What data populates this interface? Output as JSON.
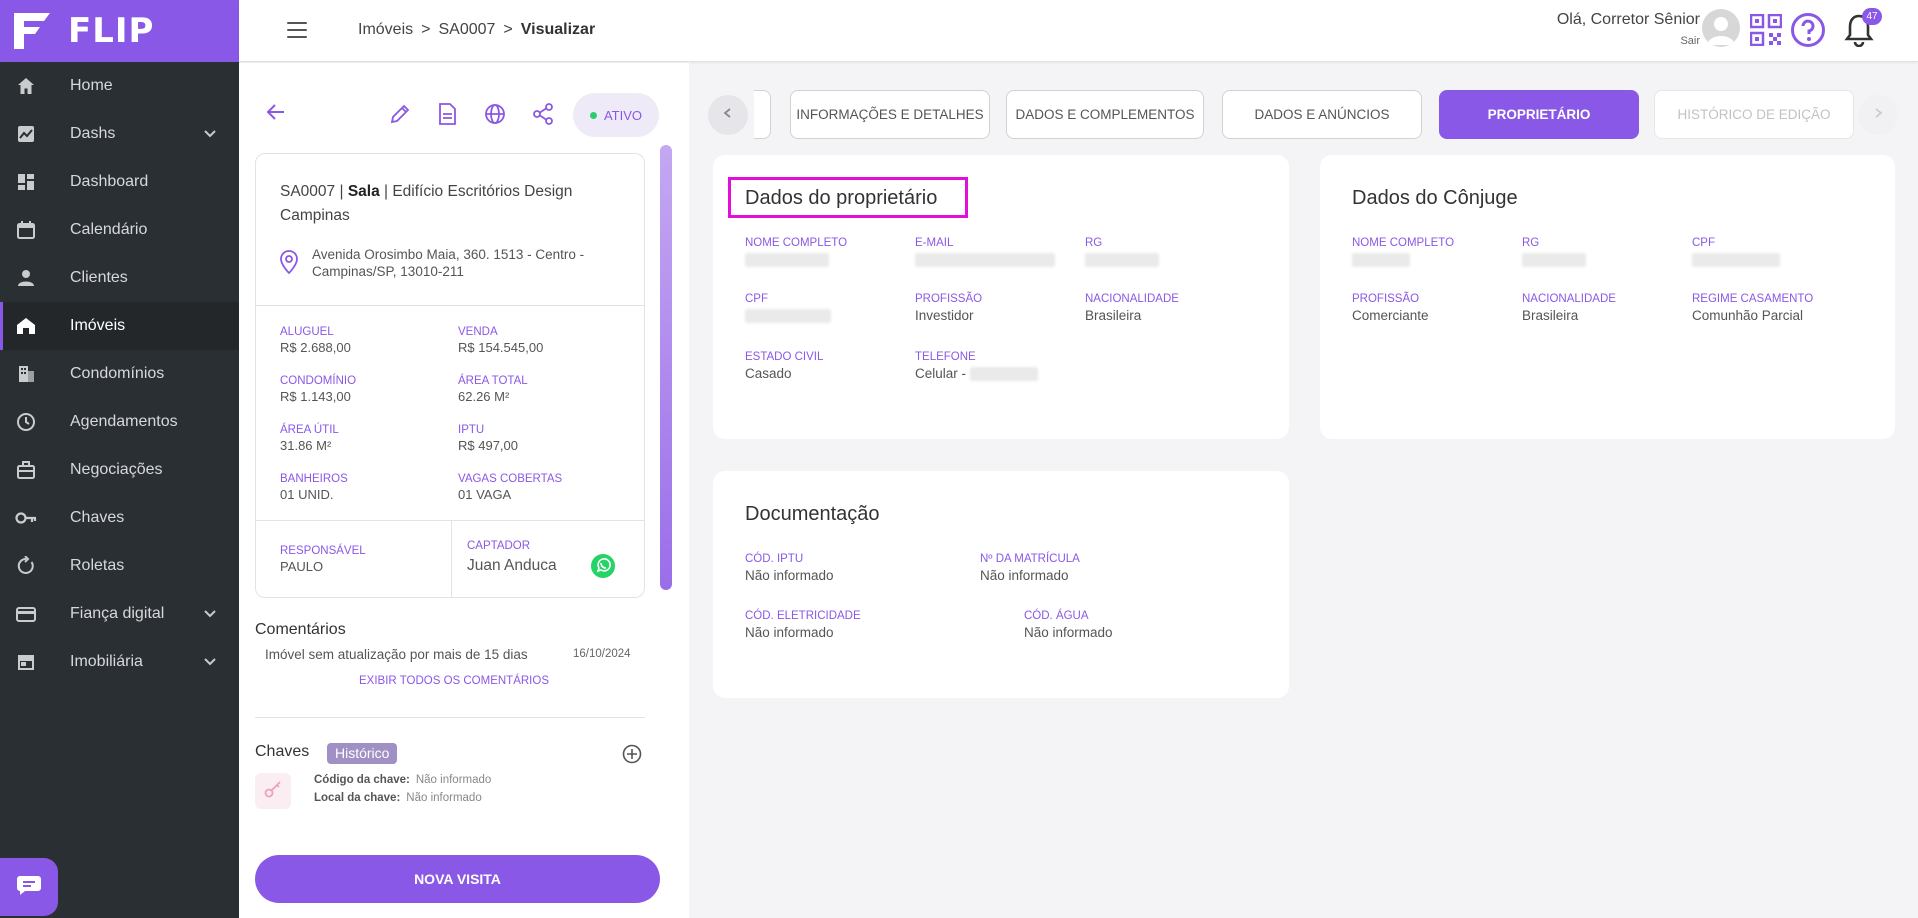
{
  "app": {
    "name": "FLIP"
  },
  "sidebar": {
    "items": [
      {
        "label": "Home",
        "icon": "home-icon",
        "active": false,
        "expandable": false
      },
      {
        "label": "Dashs",
        "icon": "chart-icon",
        "active": false,
        "expandable": true
      },
      {
        "label": "Dashboard",
        "icon": "dashboard-icon",
        "active": false,
        "expandable": false
      },
      {
        "label": "Calendário",
        "icon": "calendar-icon",
        "active": false,
        "expandable": false
      },
      {
        "label": "Clientes",
        "icon": "person-icon",
        "active": false,
        "expandable": false
      },
      {
        "label": "Imóveis",
        "icon": "house-icon",
        "active": true,
        "expandable": false
      },
      {
        "label": "Condomínios",
        "icon": "building-icon",
        "active": false,
        "expandable": false
      },
      {
        "label": "Agendamentos",
        "icon": "clock-icon",
        "active": false,
        "expandable": false
      },
      {
        "label": "Negociações",
        "icon": "briefcase-icon",
        "active": false,
        "expandable": false
      },
      {
        "label": "Chaves",
        "icon": "key-icon",
        "active": false,
        "expandable": false
      },
      {
        "label": "Roletas",
        "icon": "rotate-icon",
        "active": false,
        "expandable": false
      },
      {
        "label": "Fiança digital",
        "icon": "card-icon",
        "active": false,
        "expandable": true
      },
      {
        "label": "Imobiliária",
        "icon": "store-icon",
        "active": false,
        "expandable": true
      }
    ]
  },
  "topbar": {
    "breadcrumb": [
      "Imóveis",
      "SA0007",
      "Visualizar"
    ],
    "separator": ">",
    "greeting": "Olá, Corretor Sênior",
    "logout": "Sair",
    "notifications": "47"
  },
  "property": {
    "status": "ATIVO",
    "code": "SA0007",
    "type": "Sala",
    "name": "Edifício Escritórios Design Campinas",
    "sep": " | ",
    "address": "Avenida Orosimbo Maia, 360. 1513 - Centro - Campinas/SP, 13010-211",
    "stats": [
      {
        "label": "ALUGUEL",
        "value": "R$ 2.688,00"
      },
      {
        "label": "VENDA",
        "value": "R$ 154.545,00"
      },
      {
        "label": "CONDOMÍNIO",
        "value": "R$ 1.143,00"
      },
      {
        "label": "ÁREA TOTAL",
        "value": "62.26 M²"
      },
      {
        "label": "ÁREA ÚTIL",
        "value": "31.86 M²"
      },
      {
        "label": "IPTU",
        "value": "R$ 497,00"
      },
      {
        "label": "BANHEIROS",
        "value": "01 UNID."
      },
      {
        "label": "VAGAS COBERTAS",
        "value": "01 VAGA"
      }
    ],
    "responsible_label": "RESPONSÁVEL",
    "responsible": "PAULO",
    "captor_label": "CAPTADOR",
    "captor": "Juan Anduca"
  },
  "comments": {
    "title": "Comentários",
    "text": "Imóvel sem atualização por mais de 15 dias",
    "date": "16/10/2024",
    "show_all": "EXIBIR TODOS OS COMENTÁRIOS"
  },
  "keys": {
    "title": "Chaves",
    "history": "Histórico",
    "code_label": "Código da chave:",
    "code_value": "Não informado",
    "location_label": "Local da chave:",
    "location_value": "Não informado"
  },
  "new_visit": "NOVA VISITA",
  "tabs": [
    {
      "label": "INFORMAÇÕES E DETALHES",
      "state": "normal"
    },
    {
      "label": "DADOS E COMPLEMENTOS",
      "state": "normal"
    },
    {
      "label": "DADOS E ANÚNCIOS",
      "state": "normal"
    },
    {
      "label": "PROPRIETÁRIO",
      "state": "active"
    },
    {
      "label": "HISTÓRICO DE EDIÇÃO",
      "state": "faded"
    }
  ],
  "owner": {
    "title": "Dados do proprietário",
    "fields": [
      {
        "label": "NOME COMPLETO",
        "value": ""
      },
      {
        "label": "E-MAIL",
        "value": ""
      },
      {
        "label": "RG",
        "value": ""
      },
      {
        "label": "CPF",
        "value": ""
      },
      {
        "label": "PROFISSÃO",
        "value": "Investidor"
      },
      {
        "label": "NACIONALIDADE",
        "value": "Brasileira"
      },
      {
        "label": "ESTADO CIVIL",
        "value": "Casado"
      },
      {
        "label": "TELEFONE",
        "value": "Celular -"
      }
    ]
  },
  "spouse": {
    "title": "Dados do Cônjuge",
    "fields": [
      {
        "label": "NOME COMPLETO",
        "value": ""
      },
      {
        "label": "RG",
        "value": ""
      },
      {
        "label": "CPF",
        "value": ""
      },
      {
        "label": "PROFISSÃO",
        "value": "Comerciante"
      },
      {
        "label": "NACIONALIDADE",
        "value": "Brasileira"
      },
      {
        "label": "REGIME CASAMENTO",
        "value": "Comunhão Parcial"
      }
    ]
  },
  "documentation": {
    "title": "Documentação",
    "fields": [
      {
        "label": "CÓD. IPTU",
        "value": "Não informado"
      },
      {
        "label": "Nº DA MATRÍCULA",
        "value": "Não informado"
      },
      {
        "label": "CÓD. ELETRICIDADE",
        "value": "Não informado"
      },
      {
        "label": "CÓD. ÁGUA",
        "value": "Não informado"
      }
    ]
  },
  "colors": {
    "accent": "#8a58e6",
    "sidebar": "#2a2f33",
    "highlight": "#e10fd9",
    "status_dot": "#2ecc71"
  }
}
